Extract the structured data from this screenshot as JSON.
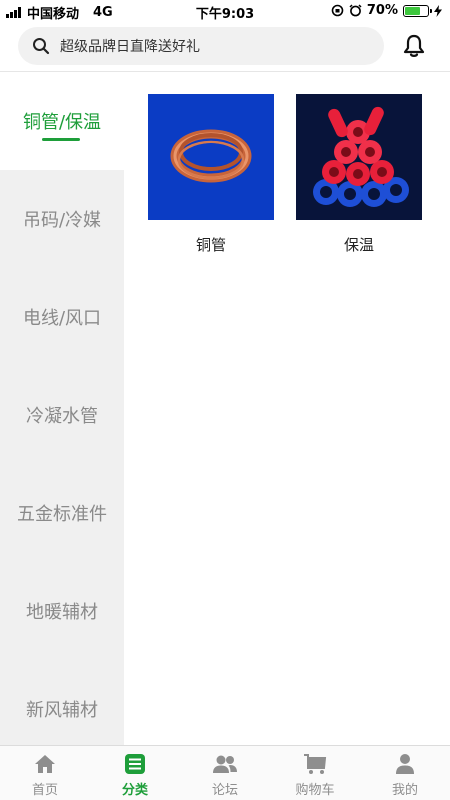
{
  "status_bar": {
    "carrier": "中国移动",
    "network": "4G",
    "time": "下午9:03",
    "battery_percent": "70%",
    "battery_level": 0.7
  },
  "header": {
    "search_placeholder": "超级品牌日直降送好礼",
    "icons": [
      "search-icon",
      "bell-icon"
    ]
  },
  "categories": [
    {
      "label": "铜管/保温",
      "active": true
    },
    {
      "label": "吊码/冷媒",
      "active": false
    },
    {
      "label": "电线/风口",
      "active": false
    },
    {
      "label": "冷凝水管",
      "active": false
    },
    {
      "label": "五金标准件",
      "active": false
    },
    {
      "label": "地暖辅材",
      "active": false
    },
    {
      "label": "新风辅材",
      "active": false
    }
  ],
  "products": [
    {
      "label": "铜管",
      "image": "copper-coil"
    },
    {
      "label": "保温",
      "image": "insulation-tubes"
    }
  ],
  "tabbar": {
    "tabs": [
      {
        "label": "首页",
        "icon": "home-icon",
        "active": false
      },
      {
        "label": "分类",
        "icon": "category-icon",
        "active": true
      },
      {
        "label": "论坛",
        "icon": "forum-icon",
        "active": false
      },
      {
        "label": "购物车",
        "icon": "cart-icon",
        "active": false
      },
      {
        "label": "我的",
        "icon": "profile-icon",
        "active": false
      }
    ]
  },
  "colors": {
    "accent": "#1e9e3a",
    "rail_background": "#f0f0f0",
    "inactive_text": "#8a8a8a"
  }
}
